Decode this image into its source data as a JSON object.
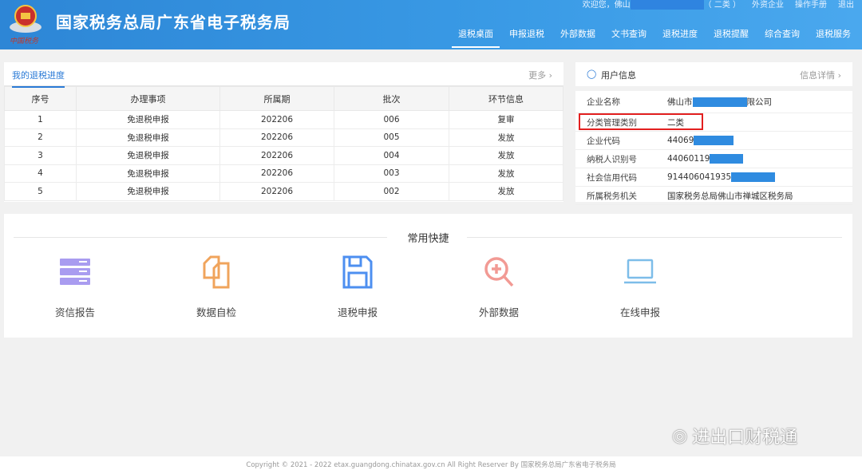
{
  "header": {
    "title": "国家税务总局广东省电子税务局",
    "motto": "中国税务",
    "welcome": "欢迎您，佛山",
    "category": "（ 二类 ）",
    "company_type": "外资企业",
    "manual": "操作手册",
    "logout": "退出",
    "nav": [
      "退税桌面",
      "申报退税",
      "外部数据",
      "文书查询",
      "退税进度",
      "退税提醒",
      "综合查询",
      "退税服务"
    ]
  },
  "progress": {
    "tab": "我的退税进度",
    "more": "更多",
    "columns": [
      "序号",
      "办理事项",
      "所属期",
      "批次",
      "环节信息"
    ],
    "rows": [
      [
        "1",
        "免退税申报",
        "202206",
        "006",
        "复审"
      ],
      [
        "2",
        "免退税申报",
        "202206",
        "005",
        "发放"
      ],
      [
        "3",
        "免退税申报",
        "202206",
        "004",
        "发放"
      ],
      [
        "4",
        "免退税申报",
        "202206",
        "003",
        "发放"
      ],
      [
        "5",
        "免退税申报",
        "202206",
        "002",
        "发放"
      ]
    ]
  },
  "user_info": {
    "title": "用户信息",
    "details": "信息详情",
    "rows": [
      {
        "k": "企业名称",
        "v": "佛山市",
        "v2": "限公司"
      },
      {
        "k": "分类管理类别",
        "v": "二类",
        "v2": ""
      },
      {
        "k": "企业代码",
        "v": "44069",
        "v2": ""
      },
      {
        "k": "纳税人识别号",
        "v": "44060119",
        "v2": ""
      },
      {
        "k": "社会信用代码",
        "v": "914406041935",
        "v2": ""
      },
      {
        "k": "所属税务机关",
        "v": "国家税务总局佛山市禅城区税务局",
        "v2": ""
      }
    ]
  },
  "shortcuts": {
    "title": "常用快捷",
    "items": [
      "资信报告",
      "数据自检",
      "退税申报",
      "外部数据",
      "在线申报"
    ]
  },
  "footer": "Copyright © 2021 - 2022 etax.guangdong.chinatax.gov.cn All Right Reserver By 国家税务总局广东省电子税务局",
  "watermark": "进出口财税通"
}
